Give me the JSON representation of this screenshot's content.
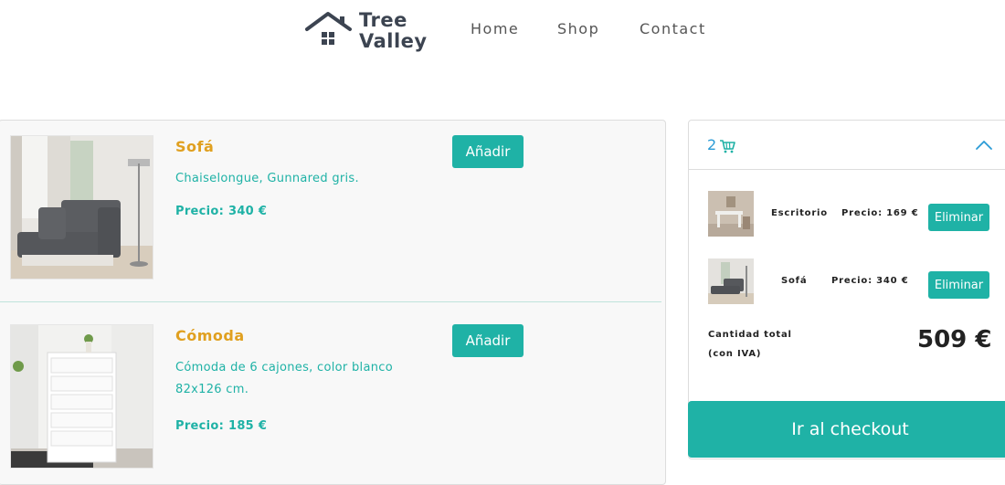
{
  "brand": {
    "line1": "Tree",
    "line2": "Valley"
  },
  "nav": {
    "home": "Home",
    "shop": "Shop",
    "contact": "Contact"
  },
  "products": [
    {
      "title": "Sofá",
      "desc": "Chaiselongue, Gunnared gris.",
      "price": "Precio: 340 €",
      "add_label": "Añadir"
    },
    {
      "title": "Cómoda",
      "desc": "Cómoda de 6 cajones, color blanco 82x126 cm.",
      "price": "Precio: 185 €",
      "add_label": "Añadir"
    }
  ],
  "cart": {
    "count": "2",
    "items": [
      {
        "name": "Escritorio",
        "price": "Precio: 169 €",
        "remove_label": "Eliminar"
      },
      {
        "name": "Sofá",
        "price": "Precio: 340 €",
        "remove_label": "Eliminar"
      }
    ],
    "total_label_1": "Cantidad total",
    "total_label_2": "(con IVA)",
    "total_value": "509 €",
    "checkout_label": "Ir al checkout"
  },
  "colors": {
    "accent": "#1fb2a6",
    "title": "#e0a020",
    "cart_link": "#2a9bd6"
  }
}
